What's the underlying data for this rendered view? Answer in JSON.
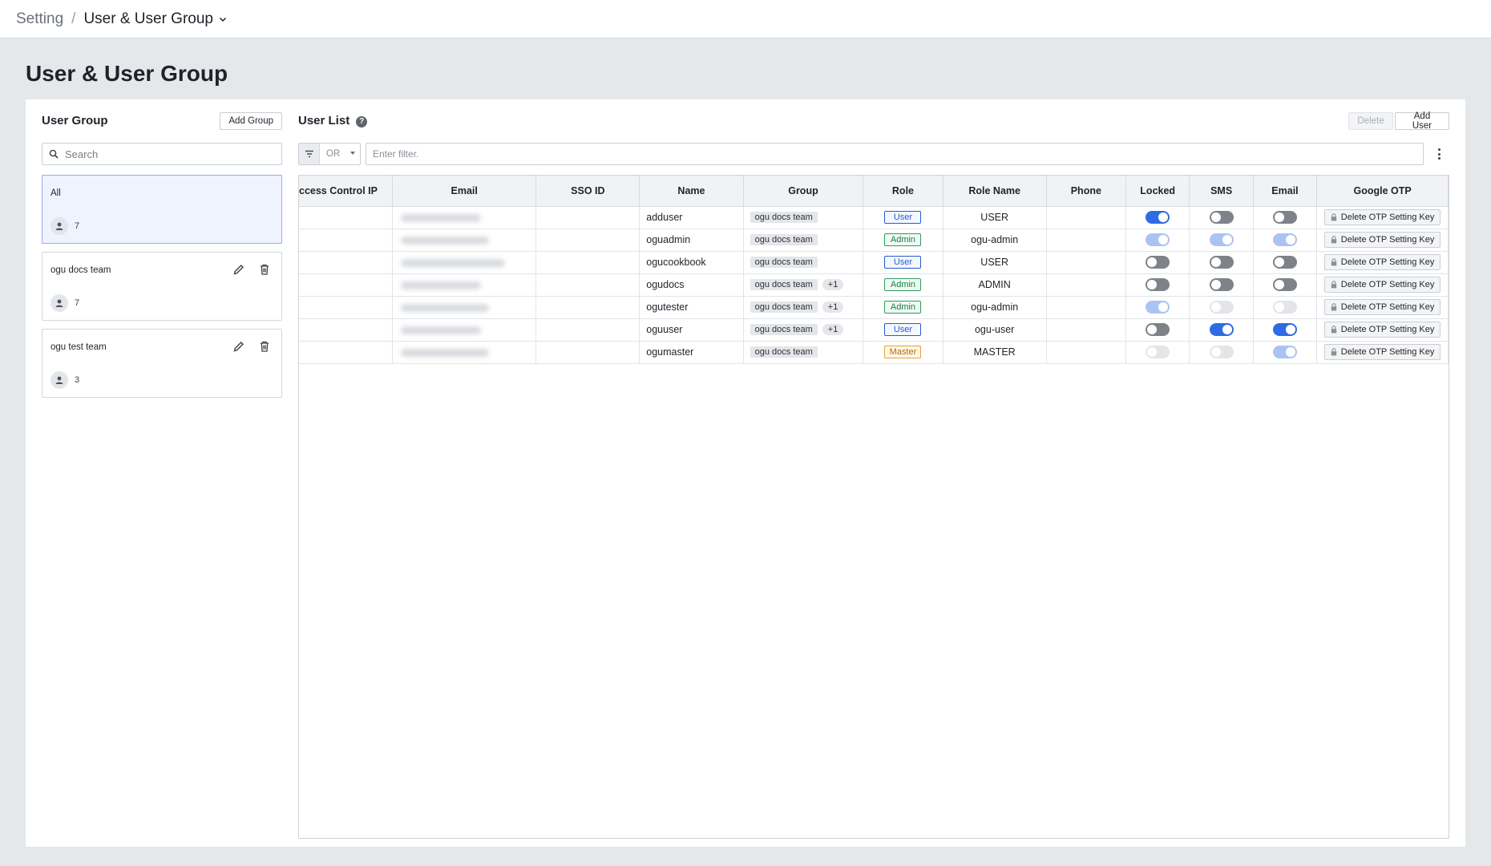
{
  "breadcrumb": {
    "parent": "Setting",
    "separator": "/",
    "current": "User & User Group"
  },
  "page_title": "User & User Group",
  "user_group_panel": {
    "title": "User Group",
    "add_button": "Add Group",
    "search_placeholder": "Search",
    "groups": [
      {
        "name": "All",
        "count": "7",
        "active": true
      },
      {
        "name": "ogu docs team",
        "count": "7"
      },
      {
        "name": "ogu test team",
        "count": "3"
      }
    ]
  },
  "user_list_panel": {
    "title": "User List",
    "help_icon": "?",
    "delete_button": "Delete",
    "add_button": "Add User",
    "filter_operator": "OR",
    "filter_placeholder": "Enter filter.",
    "columns": [
      "ccess Control IP",
      "Email",
      "SSO ID",
      "Name",
      "Group",
      "Role",
      "Role Name",
      "Phone",
      "Locked",
      "SMS",
      "Email",
      "Google OTP"
    ],
    "otp_button_label": "Delete OTP Setting Key",
    "rows": [
      {
        "name": "adduser",
        "group": "ogu docs team",
        "group_extra": "",
        "role": "User",
        "role_name": "USER",
        "locked": "on",
        "sms": "off",
        "email": "off"
      },
      {
        "name": "oguadmin",
        "group": "ogu docs team",
        "group_extra": "",
        "role": "Admin",
        "role_name": "ogu-admin",
        "locked": "on-dis",
        "sms": "on-dis",
        "email": "on-dis"
      },
      {
        "name": "ogucookbook",
        "group": "ogu docs team",
        "group_extra": "",
        "role": "User",
        "role_name": "USER",
        "locked": "off",
        "sms": "off",
        "email": "off"
      },
      {
        "name": "ogudocs",
        "group": "ogu docs team",
        "group_extra": "+1",
        "role": "Admin",
        "role_name": "ADMIN",
        "locked": "off",
        "sms": "off",
        "email": "off"
      },
      {
        "name": "ogutester",
        "group": "ogu docs team",
        "group_extra": "+1",
        "role": "Admin",
        "role_name": "ogu-admin",
        "locked": "on-dis",
        "sms": "off-dis",
        "email": "off-dis"
      },
      {
        "name": "oguuser",
        "group": "ogu docs team",
        "group_extra": "+1",
        "role": "User",
        "role_name": "ogu-user",
        "locked": "off",
        "sms": "on",
        "email": "on"
      },
      {
        "name": "ogumaster",
        "group": "ogu docs team",
        "group_extra": "",
        "role": "Master",
        "role_name": "MASTER",
        "locked": "off-dis",
        "sms": "off-dis",
        "email": "on-dis"
      }
    ]
  },
  "colors": {
    "accent": "#2e6ce4",
    "user_role": "#2a5ccf",
    "admin_role": "#177d49",
    "master_role": "#b46a00"
  }
}
